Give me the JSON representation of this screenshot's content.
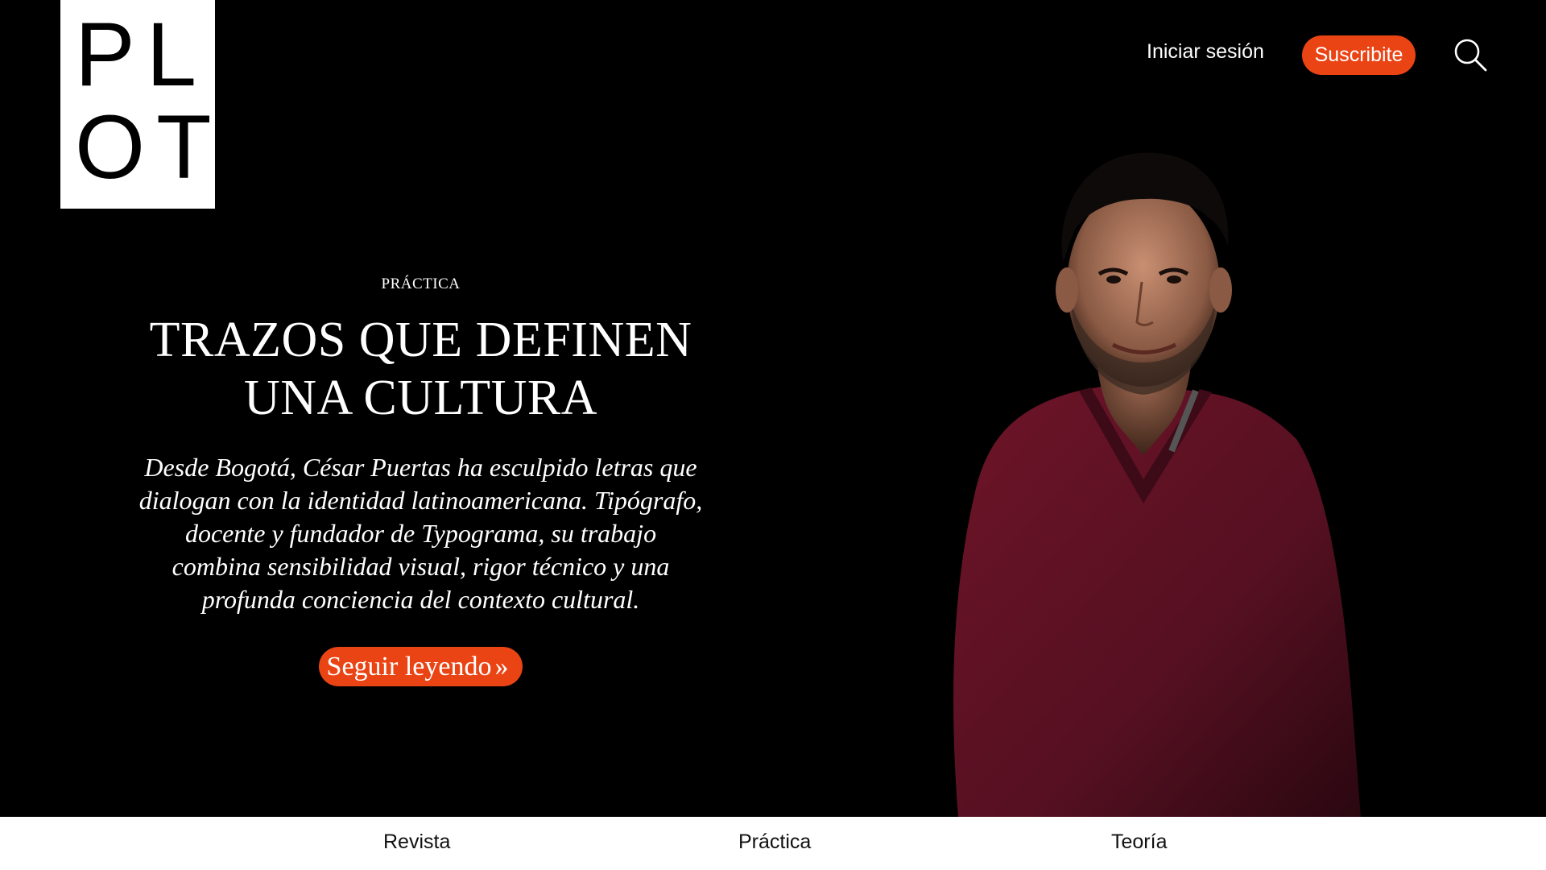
{
  "logo": {
    "line1": "PL",
    "line2": "OT"
  },
  "header": {
    "login_label": "Iniciar sesión",
    "subscribe_label": "Suscribite",
    "search_icon": "search-icon"
  },
  "hero": {
    "category": "PRÁCTICA",
    "title_line1": "TRAZOS QUE DEFINEN",
    "title_line2": "UNA CULTURA",
    "summary": "Desde Bogotá, César Puertas ha esculpido letras que dialogan con la identidad latinoamericana. Tipógrafo, docente y fundador de Typograma, su trabajo combina sensibilidad visual, rigor técnico y una profunda conciencia del contexto cultural.",
    "cta_label": "Seguir leyendo",
    "cta_icon": "double-chevron-right-icon"
  },
  "bottom_nav": {
    "items": [
      {
        "label": "Revista"
      },
      {
        "label": "Práctica"
      },
      {
        "label": "Teoría"
      }
    ]
  },
  "colors": {
    "background": "#000000",
    "accent": "#ea4415",
    "text": "#ffffff",
    "sweater": "#5e0f22"
  }
}
